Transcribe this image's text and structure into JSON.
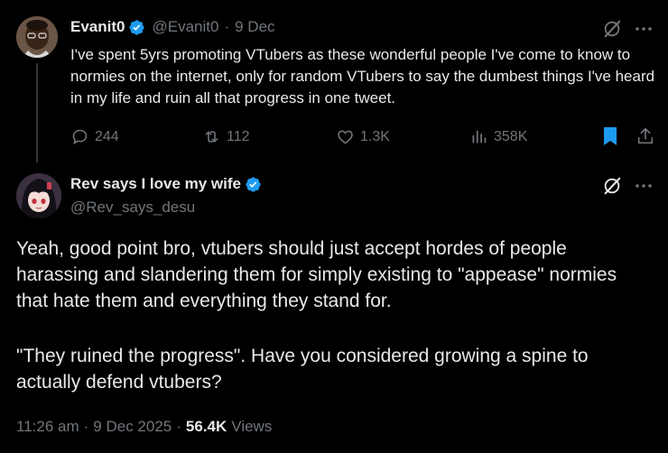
{
  "parent_tweet": {
    "display_name": "Evanit0",
    "handle": "@Evanit0",
    "separator": "·",
    "date": "9 Dec",
    "text": "I've spent 5yrs promoting VTubers as these wonderful people I've come to know to normies on the internet, only for random VTubers to say the dumbest things I've heard in my life and ruin all that progress in one tweet.",
    "stats": {
      "replies": "244",
      "reposts": "112",
      "likes": "1.3K",
      "views": "358K"
    }
  },
  "main_tweet": {
    "display_name": "Rev says I love my wife",
    "handle": "@Rev_says_desu",
    "text_para1": "Yeah, good point bro, vtubers should just accept hordes of people harassing and slandering them for simply existing to \"appease\" normies that hate them and everything they stand for.",
    "text_para2": "\"They ruined the progress\". Have you considered growing a spine to actually defend vtubers?",
    "time": "11:26 am",
    "separator": "·",
    "date": "9 Dec 2025",
    "separator2": "·",
    "views_count": "56.4K",
    "views_label": "Views"
  },
  "colors": {
    "background": "#000000",
    "text": "#e7e9ea",
    "muted": "#71767b",
    "verified": "#1d9bf0",
    "bookmark_active": "#1d9bf0",
    "thread_line": "#333639"
  },
  "icons": [
    "verified-badge-icon",
    "grok-icon",
    "more-icon",
    "reply-icon",
    "repost-icon",
    "like-icon",
    "views-icon",
    "bookmark-icon",
    "share-icon"
  ]
}
